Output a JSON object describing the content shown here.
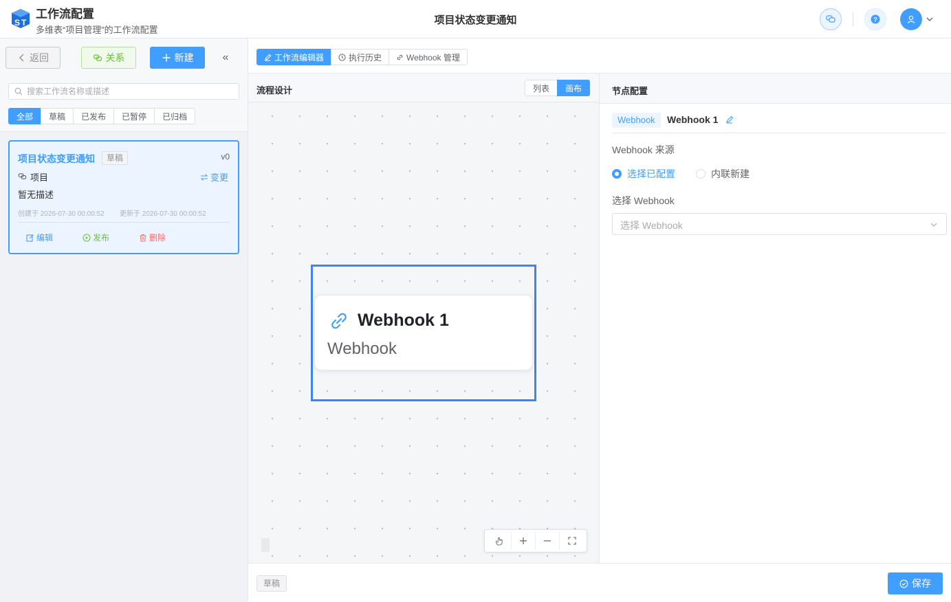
{
  "header": {
    "app_title": "工作流配置",
    "app_subtitle": "多维表“项目管理”的工作流配置",
    "page_title": "项目状态变更通知",
    "logo_text": "ST",
    "icons": [
      "chat-icon",
      "help-icon",
      "user-icon",
      "chevron-down-icon"
    ]
  },
  "sidebar": {
    "back_label": "返回",
    "relation_label": "关系",
    "new_label": "新建",
    "collapse_label": "«",
    "search_placeholder": "搜索工作流名称或描述",
    "filters": [
      {
        "label": "全部",
        "active": true
      },
      {
        "label": "草稿",
        "active": false
      },
      {
        "label": "已发布",
        "active": false
      },
      {
        "label": "已暂停",
        "active": false
      },
      {
        "label": "已归档",
        "active": false
      }
    ],
    "workflow": {
      "name": "项目状态变更通知",
      "status": "草稿",
      "version": "v0",
      "table": "项目",
      "change_label": "变更",
      "description": "暂无描述",
      "created": "创建于 2026-07-30 00:00:52",
      "updated": "更新于 2026-07-30 00:00:52",
      "edit_label": "编辑",
      "publish_label": "发布",
      "delete_label": "删除"
    }
  },
  "main": {
    "tabs": [
      {
        "label": "工作流编辑器",
        "active": true,
        "icon": "pen-icon"
      },
      {
        "label": "执行历史",
        "active": false,
        "icon": "clock-icon"
      },
      {
        "label": "Webhook 管理",
        "active": false,
        "icon": "link-icon"
      }
    ],
    "canvas": {
      "title": "流程设计",
      "view_list": "列表",
      "view_canvas": "画布",
      "node": {
        "title": "Webhook 1",
        "type": "Webhook"
      }
    },
    "config": {
      "title": "节点配置",
      "type_tag": "Webhook",
      "node_name": "Webhook 1",
      "source_label": "Webhook 来源",
      "radio_existing": "选择已配置",
      "radio_inline": "内联新建",
      "select_label": "选择 Webhook",
      "select_placeholder": "选择 Webhook"
    }
  },
  "footer": {
    "status": "草稿",
    "save_label": "保存"
  },
  "colors": {
    "primary": "#409eff",
    "success": "#67c23a",
    "danger": "#f56c6c",
    "selection": "#3b82f6"
  }
}
